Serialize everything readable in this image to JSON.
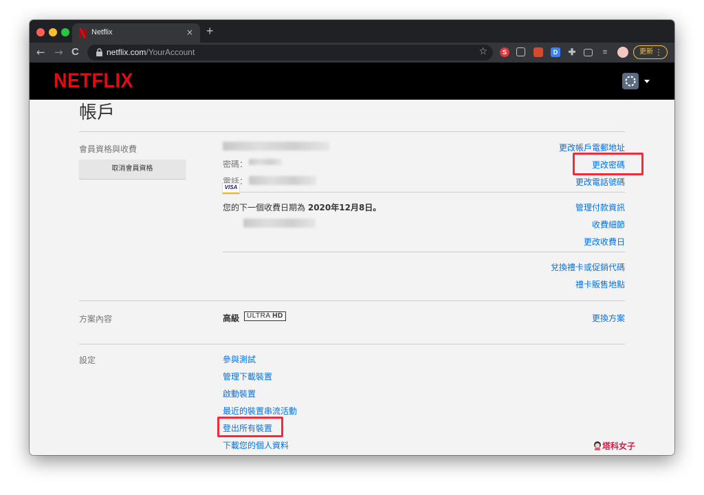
{
  "browser": {
    "tab_title": "Netflix",
    "tab_close": "×",
    "new_tab": "+",
    "url_host": "netflix.com",
    "url_path": "/YourAccount",
    "back": "←",
    "forward": "→",
    "reload": "C",
    "bookmark_star": "☆",
    "update_label": "更新",
    "menu_dots": "⋮"
  },
  "header": {
    "logo": "NETFLIX"
  },
  "account": {
    "title": "帳戶",
    "membership": {
      "section_label": "會員資格與收費",
      "cancel_button": "取消會員資格",
      "password_label": "密碼：",
      "phone_label": "電話：",
      "links": {
        "change_email": "更改帳戶電郵地址",
        "change_password": "更改密碼",
        "change_phone": "更改電話號碼"
      }
    },
    "billing": {
      "next_billing_prefix": "您的下一個收費日期為",
      "next_billing_date": "2020年12月8日。",
      "card_brand": "VISA",
      "links": {
        "manage_payment": "管理付款資訊",
        "billing_details": "收費細節",
        "change_billing_day": "更改收費日"
      }
    },
    "gift": {
      "redeem": "兌換禮卡或促銷代碼",
      "where_to_buy": "禮卡販售地點"
    },
    "plan": {
      "section_label": "方案內容",
      "plan_name": "高級",
      "badge_text": "ULTRA",
      "badge_bold": "HD",
      "change_plan": "更換方案"
    },
    "settings": {
      "section_label": "設定",
      "links": [
        "參與測試",
        "管理下載裝置",
        "啟動裝置",
        "最近的裝置串流活動",
        "登出所有裝置",
        "下載您的個人資料"
      ]
    }
  },
  "watermark": "塔科女子",
  "colors": {
    "netflix_red": "#e50914",
    "link_blue": "#0073e6",
    "highlight_red": "#f02b3c"
  }
}
